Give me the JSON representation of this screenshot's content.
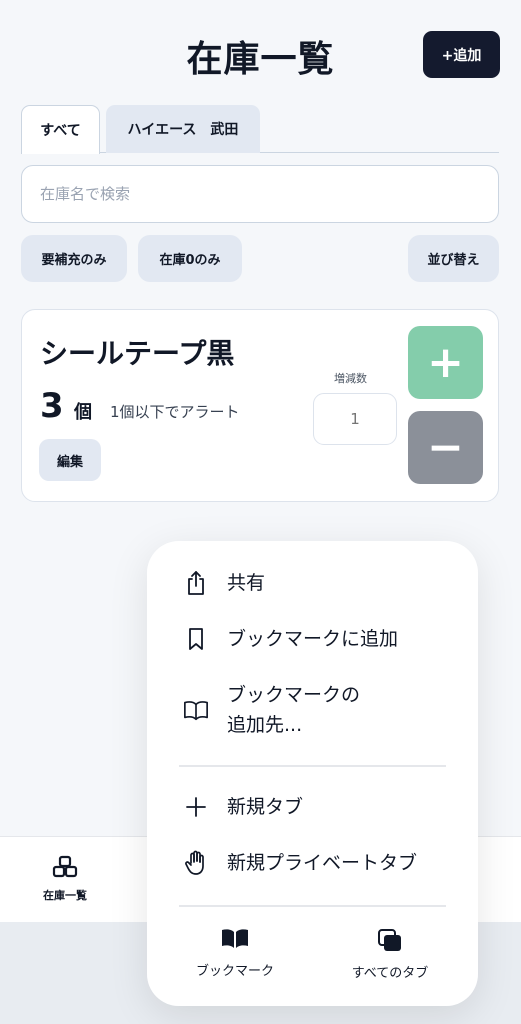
{
  "header": {
    "title": "在庫一覧",
    "add_label": "+追加"
  },
  "tabs": [
    {
      "label": "すべて"
    },
    {
      "label": "ハイエース　武田"
    }
  ],
  "search": {
    "placeholder": "在庫名で検索",
    "value": ""
  },
  "filters": {
    "restock_label": "要補充のみ",
    "zero_label": "在庫0のみ",
    "sort_label": "並び替え"
  },
  "item": {
    "name": "シールテープ黒",
    "quantity": "3",
    "unit": "個",
    "alert": "1個以下でアラート",
    "edit_label": "編集",
    "delta_label": "増減数",
    "delta_placeholder": "1",
    "plus_label": "+",
    "minus_label": "−"
  },
  "bottom_nav": {
    "home_label": "在庫一覧"
  },
  "menu": {
    "share": "共有",
    "add_bookmark": "ブックマークに追加",
    "bookmark_to_line1": "ブックマークの",
    "bookmark_to_line2": "追加先...",
    "new_tab": "新規タブ",
    "new_private_tab": "新規プライベートタブ",
    "bookmarks": "ブックマーク",
    "all_tabs": "すべてのタブ"
  },
  "colors": {
    "plus": "#84cdab",
    "minus": "#8b9099",
    "add_button": "#141a2e"
  }
}
